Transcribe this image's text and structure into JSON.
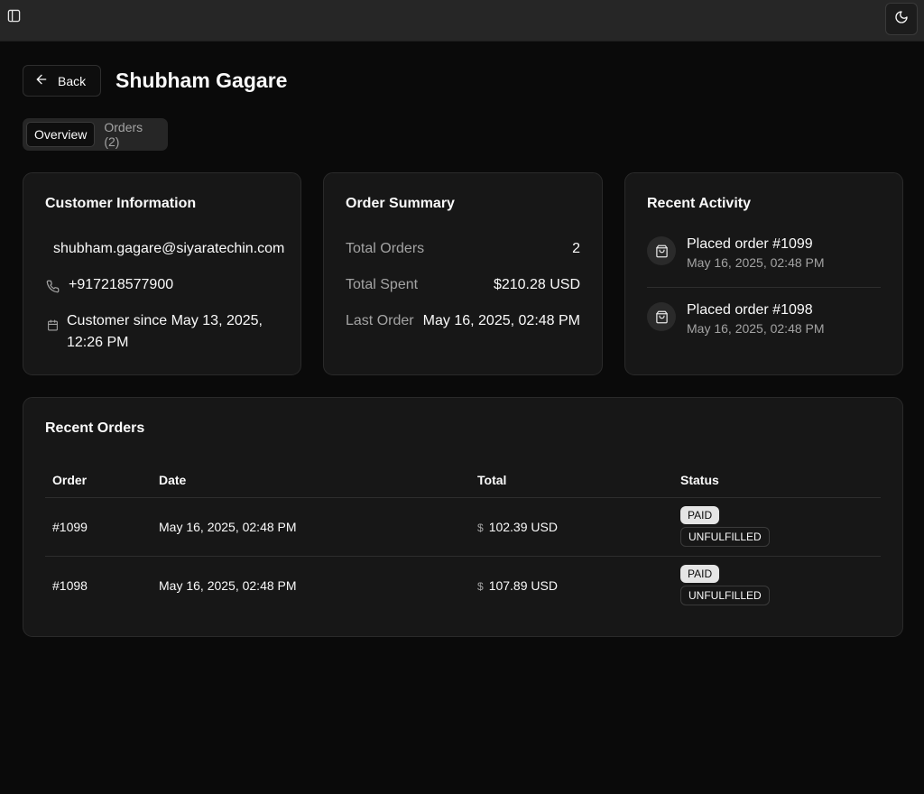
{
  "header": {
    "sidebar_toggle_icon": "sidebar-icon",
    "theme_icon": "moon-icon"
  },
  "back_button": {
    "label": "Back",
    "icon": "arrow-left-icon"
  },
  "page_title": "Shubham Gagare",
  "tabs": [
    {
      "label": "Overview",
      "active": true
    },
    {
      "label": "Orders (2)",
      "active": false
    }
  ],
  "customer_info": {
    "title": "Customer Information",
    "email": "shubham.gagare@siyaratechin.com",
    "phone": "+917218577900",
    "since_line1": "Customer since May 13, 2025,",
    "since_line2": "12:26 PM"
  },
  "order_summary": {
    "title": "Order Summary",
    "rows": [
      {
        "label": "Total Orders",
        "value": "2"
      },
      {
        "label": "Total Spent",
        "value": "$210.28 USD"
      },
      {
        "label": "Last Order",
        "value": "May 16, 2025, 02:48 PM"
      }
    ]
  },
  "recent_activity": {
    "title": "Recent Activity",
    "items": [
      {
        "title": "Placed order #1099",
        "date": "May 16, 2025, 02:48 PM",
        "icon": "shopping-bag-icon"
      },
      {
        "title": "Placed order #1098",
        "date": "May 16, 2025, 02:48 PM",
        "icon": "shopping-bag-icon"
      }
    ]
  },
  "recent_orders": {
    "title": "Recent Orders",
    "columns": [
      "Order",
      "Date",
      "Total",
      "Status"
    ],
    "rows": [
      {
        "order": "#1099",
        "date": "May 16, 2025, 02:48 PM",
        "currency_symbol": "$",
        "total": "102.39 USD",
        "payment": "PAID",
        "fulfillment": "UNFULFILLED"
      },
      {
        "order": "#1098",
        "date": "May 16, 2025, 02:48 PM",
        "currency_symbol": "$",
        "total": "107.89 USD",
        "payment": "PAID",
        "fulfillment": "UNFULFILLED"
      }
    ]
  }
}
